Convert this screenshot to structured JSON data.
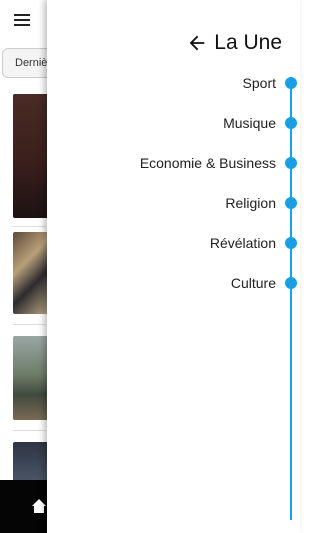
{
  "background": {
    "filter_chip": "Derniè"
  },
  "drawer": {
    "title": "La Une",
    "items": [
      {
        "label": "Sport"
      },
      {
        "label": "Musique"
      },
      {
        "label": "Economie & Business"
      },
      {
        "label": "Religion"
      },
      {
        "label": "Révélation"
      },
      {
        "label": "Culture"
      }
    ]
  },
  "colors": {
    "accent": "#1a9ee4",
    "bottom_bar": "#050505"
  },
  "icons": [
    "menu-icon",
    "back-arrow-icon",
    "home-icon"
  ]
}
